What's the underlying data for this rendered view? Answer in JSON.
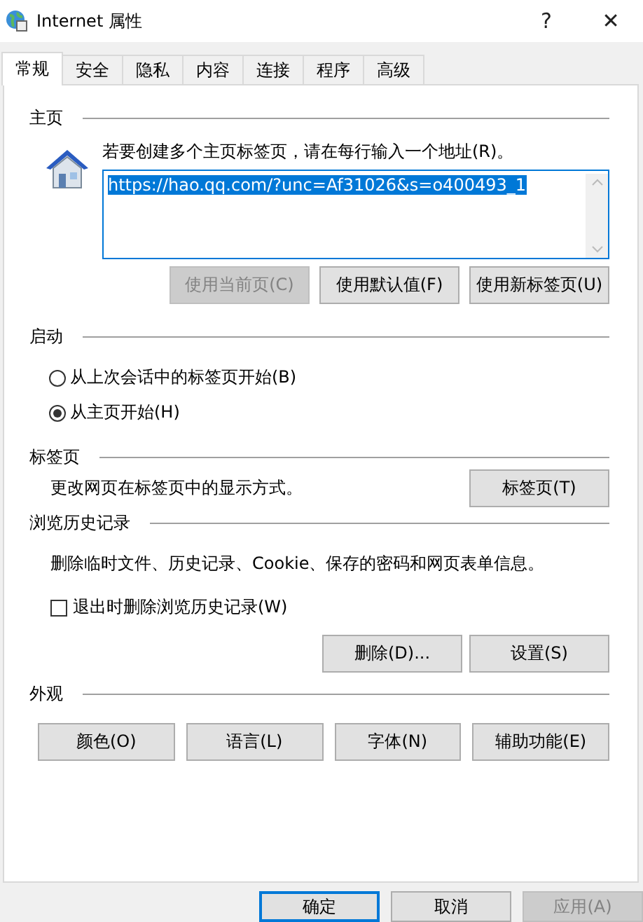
{
  "window": {
    "title": "Internet 属性",
    "help_glyph": "?",
    "close_glyph": "✕"
  },
  "tabs": [
    {
      "label": "常规",
      "selected": true
    },
    {
      "label": "安全",
      "selected": false
    },
    {
      "label": "隐私",
      "selected": false
    },
    {
      "label": "内容",
      "selected": false
    },
    {
      "label": "连接",
      "selected": false
    },
    {
      "label": "程序",
      "selected": false
    },
    {
      "label": "高级",
      "selected": false
    }
  ],
  "home": {
    "heading": "主页",
    "prompt": "若要创建多个主页标签页，请在每行输入一个地址(R)。",
    "address": {
      "value": "https://hao.qq.com/?unc=Af31026&s=o400493_1",
      "selected": true
    },
    "buttons": [
      {
        "label": "使用当前页(C)",
        "disabled": true
      },
      {
        "label": "使用默认值(F)",
        "disabled": false
      },
      {
        "label": "使用新标签页(U)",
        "disabled": false
      }
    ]
  },
  "startup": {
    "heading": "启动",
    "options": [
      {
        "label": "从上次会话中的标签页开始(B)",
        "selected": false
      },
      {
        "label": "从主页开始(H)",
        "selected": true
      }
    ]
  },
  "tab_settings": {
    "heading": "标签页",
    "description": "更改网页在标签页中的显示方式。",
    "button": "标签页(T)"
  },
  "history": {
    "heading": "浏览历史记录",
    "description": "删除临时文件、历史记录、Cookie、保存的密码和网页表单信息。",
    "checkbox": {
      "label": "退出时删除浏览历史记录(W)",
      "checked": false
    },
    "buttons": [
      "删除(D)...",
      "设置(S)"
    ]
  },
  "appearance": {
    "heading": "外观",
    "buttons": [
      "颜色(O)",
      "语言(L)",
      "字体(N)",
      "辅助功能(E)"
    ]
  },
  "footer_buttons": [
    {
      "label": "确定",
      "default": true,
      "disabled": false
    },
    {
      "label": "取消",
      "default": false,
      "disabled": false
    },
    {
      "label": "应用(A)",
      "default": false,
      "disabled": true
    }
  ]
}
